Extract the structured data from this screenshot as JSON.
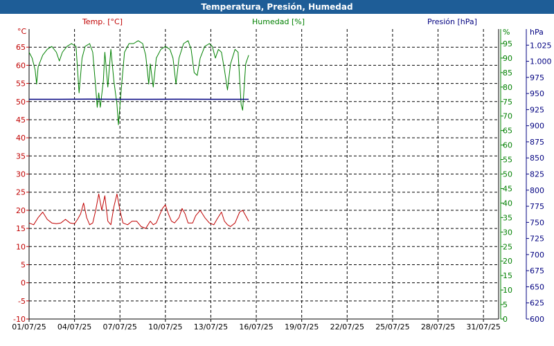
{
  "window": {
    "title": "Temperatura, Presión, Humedad"
  },
  "colors": {
    "titlebar": "#1e5d97",
    "temp": "#c00000",
    "hum": "#008000",
    "pres": "#000080",
    "grid": "#000000",
    "background": "#ffffff"
  },
  "chart_data": {
    "type": "line",
    "title": "Temperatura, Presión, Humedad",
    "grid": true,
    "x": {
      "label": "",
      "range": [
        1,
        32
      ],
      "ticks": [
        1,
        4,
        7,
        10,
        13,
        16,
        19,
        22,
        25,
        28,
        31
      ],
      "tick_labels": [
        "01/07/25",
        "04/07/25",
        "07/07/25",
        "10/07/25",
        "13/07/25",
        "16/07/25",
        "19/07/25",
        "22/07/25",
        "25/07/25",
        "28/07/25",
        "31/07/25"
      ]
    },
    "axes": {
      "temp": {
        "label": "Temp. [°C]",
        "unit": "°C",
        "range": [
          -10,
          70
        ],
        "ticks": [
          -10,
          -5,
          0,
          5,
          10,
          15,
          20,
          25,
          30,
          35,
          40,
          45,
          50,
          55,
          60,
          65
        ],
        "tick_labels": [
          "-10",
          "-5",
          "0",
          "5",
          "10",
          "15",
          "20",
          "25",
          "30",
          "35",
          "40",
          "45",
          "50",
          "55",
          "60",
          "65"
        ]
      },
      "hum": {
        "label": "Humedad [%]",
        "unit": "%",
        "range": [
          0,
          100
        ],
        "ticks": [
          0,
          5,
          10,
          15,
          20,
          25,
          30,
          35,
          40,
          45,
          50,
          55,
          60,
          65,
          70,
          75,
          80,
          85,
          90,
          95
        ],
        "tick_labels": [
          "0",
          "5",
          "10",
          "15",
          "20",
          "25",
          "30",
          "35",
          "40",
          "45",
          "50",
          "55",
          "60",
          "65",
          "70",
          "75",
          "80",
          "85",
          "90",
          "95"
        ]
      },
      "pres": {
        "label": "Presión [hPa]",
        "unit": "hPa",
        "range": [
          600,
          1050
        ],
        "ticks": [
          600,
          625,
          650,
          675,
          700,
          725,
          750,
          775,
          800,
          825,
          850,
          875,
          900,
          925,
          950,
          975,
          1000,
          1025
        ],
        "tick_labels": [
          "600",
          "625",
          "650",
          "675",
          "700",
          "725",
          "750",
          "775",
          "800",
          "825",
          "850",
          "875",
          "900",
          "925",
          "950",
          "975",
          "1.000",
          "1.025"
        ]
      }
    },
    "series": [
      {
        "name": "Temp. [°C]",
        "axis": "temp",
        "color": "#c00000",
        "points": [
          [
            1.0,
            16.5
          ],
          [
            1.3,
            16.0
          ],
          [
            1.6,
            18.0
          ],
          [
            1.9,
            19.5
          ],
          [
            2.2,
            17.5
          ],
          [
            2.5,
            16.5
          ],
          [
            2.8,
            16.3
          ],
          [
            3.1,
            16.5
          ],
          [
            3.4,
            17.5
          ],
          [
            3.7,
            16.5
          ],
          [
            4.0,
            16.3
          ],
          [
            4.2,
            17.5
          ],
          [
            4.4,
            19.0
          ],
          [
            4.6,
            22.0
          ],
          [
            4.8,
            18.0
          ],
          [
            5.0,
            16.0
          ],
          [
            5.2,
            16.5
          ],
          [
            5.4,
            20.0
          ],
          [
            5.6,
            24.5
          ],
          [
            5.8,
            20.0
          ],
          [
            6.0,
            24.0
          ],
          [
            6.2,
            17.0
          ],
          [
            6.4,
            16.0
          ],
          [
            6.6,
            21.0
          ],
          [
            6.8,
            24.5
          ],
          [
            7.0,
            20.0
          ],
          [
            7.2,
            16.5
          ],
          [
            7.5,
            16.0
          ],
          [
            7.8,
            17.0
          ],
          [
            8.1,
            17.0
          ],
          [
            8.4,
            15.5
          ],
          [
            8.7,
            15.0
          ],
          [
            9.0,
            17.0
          ],
          [
            9.2,
            16.0
          ],
          [
            9.4,
            16.5
          ],
          [
            9.6,
            18.5
          ],
          [
            9.8,
            20.5
          ],
          [
            10.0,
            21.5
          ],
          [
            10.2,
            19.0
          ],
          [
            10.4,
            17.0
          ],
          [
            10.6,
            16.5
          ],
          [
            10.9,
            18.0
          ],
          [
            11.1,
            20.5
          ],
          [
            11.3,
            19.0
          ],
          [
            11.5,
            16.5
          ],
          [
            11.8,
            16.5
          ],
          [
            12.0,
            18.5
          ],
          [
            12.3,
            20.0
          ],
          [
            12.6,
            18.0
          ],
          [
            12.9,
            16.5
          ],
          [
            13.2,
            16.0
          ],
          [
            13.4,
            17.5
          ],
          [
            13.7,
            19.5
          ],
          [
            13.9,
            17.0
          ],
          [
            14.1,
            16.0
          ],
          [
            14.3,
            15.5
          ],
          [
            14.6,
            16.5
          ],
          [
            14.9,
            19.5
          ],
          [
            15.1,
            20.0
          ],
          [
            15.3,
            18.5
          ],
          [
            15.5,
            17.0
          ]
        ]
      },
      {
        "name": "Humedad [%]",
        "axis": "hum",
        "color": "#008000",
        "points": [
          [
            1.0,
            92.0
          ],
          [
            1.2,
            90.0
          ],
          [
            1.4,
            86.0
          ],
          [
            1.5,
            81.0
          ],
          [
            1.6,
            87.0
          ],
          [
            1.9,
            91.0
          ],
          [
            2.2,
            93.0
          ],
          [
            2.5,
            94.0
          ],
          [
            2.8,
            92.0
          ],
          [
            3.0,
            89.0
          ],
          [
            3.2,
            92.0
          ],
          [
            3.5,
            94.0
          ],
          [
            3.8,
            95.0
          ],
          [
            4.1,
            94.0
          ],
          [
            4.3,
            78.0
          ],
          [
            4.5,
            90.0
          ],
          [
            4.7,
            94.0
          ],
          [
            5.0,
            95.0
          ],
          [
            5.2,
            92.0
          ],
          [
            5.4,
            80.0
          ],
          [
            5.5,
            73.0
          ],
          [
            5.6,
            78.0
          ],
          [
            5.7,
            73.0
          ],
          [
            5.9,
            82.0
          ],
          [
            6.0,
            92.0
          ],
          [
            6.2,
            80.0
          ],
          [
            6.4,
            93.0
          ],
          [
            6.6,
            82.0
          ],
          [
            6.8,
            74.0
          ],
          [
            6.9,
            67.0
          ],
          [
            7.1,
            80.0
          ],
          [
            7.3,
            92.0
          ],
          [
            7.6,
            95.0
          ],
          [
            7.9,
            95.0
          ],
          [
            8.2,
            96.0
          ],
          [
            8.5,
            95.0
          ],
          [
            8.7,
            91.0
          ],
          [
            8.9,
            81.0
          ],
          [
            9.0,
            88.0
          ],
          [
            9.2,
            80.0
          ],
          [
            9.4,
            90.0
          ],
          [
            9.7,
            93.0
          ],
          [
            10.0,
            94.0
          ],
          [
            10.3,
            93.0
          ],
          [
            10.5,
            90.0
          ],
          [
            10.7,
            81.0
          ],
          [
            10.9,
            90.0
          ],
          [
            11.2,
            95.0
          ],
          [
            11.5,
            96.0
          ],
          [
            11.7,
            93.0
          ],
          [
            11.9,
            85.0
          ],
          [
            12.1,
            84.0
          ],
          [
            12.3,
            90.0
          ],
          [
            12.6,
            94.0
          ],
          [
            12.9,
            95.0
          ],
          [
            13.1,
            94.0
          ],
          [
            13.3,
            90.0
          ],
          [
            13.5,
            93.0
          ],
          [
            13.7,
            92.0
          ],
          [
            13.9,
            86.0
          ],
          [
            14.1,
            79.0
          ],
          [
            14.3,
            88.0
          ],
          [
            14.6,
            93.0
          ],
          [
            14.8,
            92.0
          ],
          [
            15.0,
            74.0
          ],
          [
            15.1,
            72.0
          ],
          [
            15.3,
            88.0
          ],
          [
            15.5,
            91.0
          ]
        ]
      },
      {
        "name": "Presión [hPa]",
        "axis": "pres",
        "color": "#000080",
        "points": [
          [
            1.0,
            941.0
          ],
          [
            3.0,
            941.0
          ],
          [
            5.0,
            941.2
          ],
          [
            7.0,
            941.0
          ],
          [
            9.0,
            941.0
          ],
          [
            11.0,
            941.1
          ],
          [
            13.0,
            941.0
          ],
          [
            15.5,
            941.0
          ]
        ]
      }
    ]
  }
}
